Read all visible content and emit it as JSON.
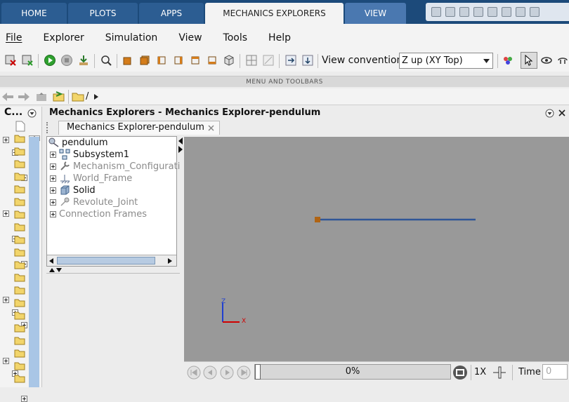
{
  "ribbon": {
    "tabs": [
      "HOME",
      "PLOTS",
      "APPS",
      "MECHANICS EXPLORERS",
      "VIEW"
    ],
    "active_tab": "MECHANICS EXPLORERS"
  },
  "menu": {
    "items": [
      "File",
      "Explorer",
      "Simulation",
      "View",
      "Tools",
      "Help"
    ]
  },
  "toolbar": {
    "view_convention_label": "View convention:",
    "view_convention_value": "Z up (XY Top)",
    "strip_label": "MENU AND TOOLBARS"
  },
  "address": {
    "path": "/"
  },
  "left_panel": {
    "title": "C..."
  },
  "explorer": {
    "title": "Mechanics Explorers - Mechanics Explorer-pendulum",
    "doc_tab": "Mechanics Explorer-pendulum",
    "tree": {
      "root": "pendulum",
      "children": [
        {
          "label": "Subsystem1",
          "enabled": true
        },
        {
          "label": "Mechanism_Configurati",
          "enabled": false
        },
        {
          "label": "World_Frame",
          "enabled": false
        },
        {
          "label": "Solid",
          "enabled": true
        },
        {
          "label": "Revolute_Joint",
          "enabled": false
        },
        {
          "label": "Connection Frames",
          "enabled": false
        }
      ]
    }
  },
  "view": {
    "axis_z": "Z",
    "axis_x": "X"
  },
  "playback": {
    "progress_text": "0%",
    "progress": 0,
    "speed": "1X",
    "time_label": "Time",
    "time_value": "0"
  },
  "colors": {
    "ribbon_bg": "#1c4a7a",
    "canvas_bg": "#999999",
    "pendulum_line": "#2f5597",
    "pivot": "#b06414"
  }
}
